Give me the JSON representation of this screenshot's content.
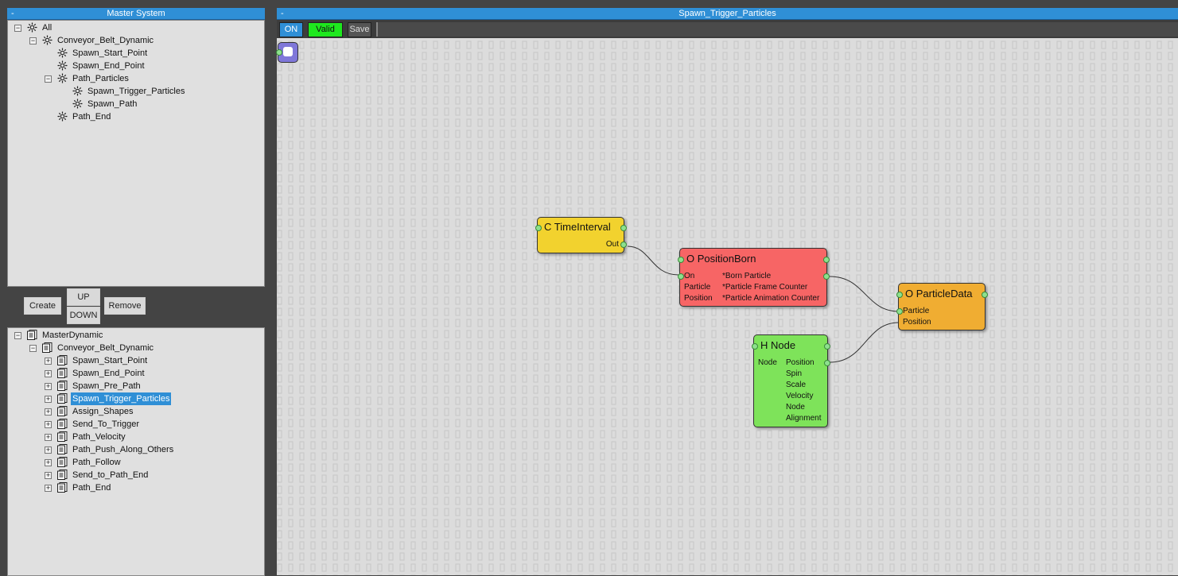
{
  "master_system": {
    "title": "Master System",
    "collapse": "-",
    "tree": [
      {
        "label": "All",
        "box": "−"
      },
      {
        "label": "Conveyor_Belt_Dynamic",
        "box": "−"
      },
      {
        "label": "Spawn_Start_Point",
        "box": ""
      },
      {
        "label": "Spawn_End_Point",
        "box": ""
      },
      {
        "label": "Path_Particles",
        "box": "−"
      },
      {
        "label": "Spawn_Trigger_Particles",
        "box": ""
      },
      {
        "label": "Spawn_Path",
        "box": ""
      },
      {
        "label": "Path_End",
        "box": ""
      }
    ]
  },
  "buttons": {
    "create": "Create",
    "up": "UP",
    "down": "DOWN",
    "remove": "Remove"
  },
  "dynamic_tree": [
    {
      "label": "MasterDynamic",
      "box": "−"
    },
    {
      "label": "Conveyor_Belt_Dynamic",
      "box": "−"
    },
    {
      "label": "Spawn_Start_Point",
      "box": "+"
    },
    {
      "label": "Spawn_End_Point",
      "box": "+"
    },
    {
      "label": "Spawn_Pre_Path",
      "box": "+"
    },
    {
      "label": "Spawn_Trigger_Particles",
      "box": "+",
      "selected": true
    },
    {
      "label": "Assign_Shapes",
      "box": "+"
    },
    {
      "label": "Send_To_Trigger",
      "box": "+"
    },
    {
      "label": "Path_Velocity",
      "box": "+"
    },
    {
      "label": "Path_Push_Along_Others",
      "box": "+"
    },
    {
      "label": "Path_Follow",
      "box": "+"
    },
    {
      "label": "Send_to_Path_End",
      "box": "+"
    },
    {
      "label": "Path_End",
      "box": "+"
    }
  ],
  "editor": {
    "title": "Spawn_Trigger_Particles",
    "collapse": "-",
    "toolbar": {
      "on": "ON",
      "valid": "Valid",
      "save": "Save"
    }
  },
  "nodes": {
    "time_interval": {
      "title": "C TimeInterval",
      "out": "Out",
      "color": "#f2d22e"
    },
    "position_born": {
      "title": "O PositionBorn",
      "color": "#f76565",
      "inputs": [
        "On",
        "Particle",
        "Position"
      ],
      "outputs": [
        "*Born Particle",
        "*Particle Frame Counter",
        "*Particle Animation Counter"
      ]
    },
    "particle_data": {
      "title": "O ParticleData",
      "color": "#f0ad32",
      "inputs": [
        "Particle",
        "Position"
      ]
    },
    "h_node": {
      "title": "H Node",
      "color": "#7ee35a",
      "input": "Node",
      "outputs": [
        "Position",
        "Spin",
        "Scale",
        "Velocity",
        "Node",
        "Alignment"
      ]
    }
  }
}
